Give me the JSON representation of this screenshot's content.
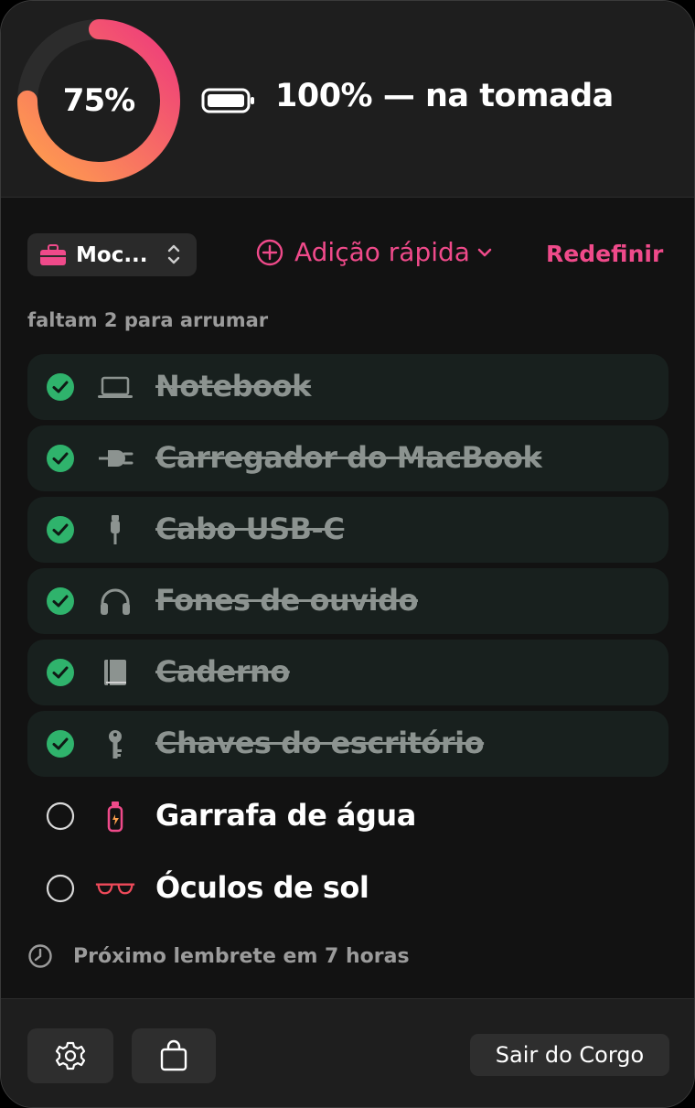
{
  "header": {
    "progress_label": "75%",
    "progress_fraction": 0.75,
    "battery_status": "100% — na tomada"
  },
  "toolbar": {
    "list_name": "Moc...",
    "quick_add_label": "Adição rápida",
    "reset_label": "Redefinir"
  },
  "remaining_text": "faltam 2 para arrumar",
  "items": [
    {
      "label": "Notebook",
      "icon": "laptop-icon",
      "checked": true
    },
    {
      "label": "Carregador do MacBook",
      "icon": "power-plug-icon",
      "checked": true
    },
    {
      "label": "Cabo USB-C",
      "icon": "cable-icon",
      "checked": true
    },
    {
      "label": "Fones de ouvido",
      "icon": "headphones-icon",
      "checked": true
    },
    {
      "label": "Caderno",
      "icon": "book-icon",
      "checked": true
    },
    {
      "label": "Chaves do escritório",
      "icon": "key-icon",
      "checked": true
    },
    {
      "label": "Garrafa de água",
      "icon": "water-bottle-icon",
      "checked": false
    },
    {
      "label": "Óculos de sol",
      "icon": "sunglasses-icon",
      "checked": false
    }
  ],
  "reminder_text": "Próximo lembrete em 7 horas",
  "footer": {
    "quit_label": "Sair do Corgo"
  },
  "colors": {
    "accent": "#ef4a8a",
    "ring_start": "#ff8a4c",
    "ring_end": "#ef3d7b",
    "check_green": "#2fb36c"
  }
}
